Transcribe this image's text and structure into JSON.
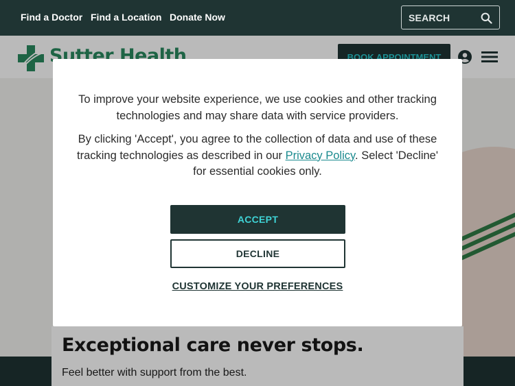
{
  "topbar": {
    "links": [
      "Find a Doctor",
      "Find a Location",
      "Donate Now"
    ],
    "search_placeholder": "SEARCH",
    "search_icon": "search-icon"
  },
  "header": {
    "logo_text": "Sutter Health",
    "book_label": "BOOK APPOINTMENT",
    "account_icon": "account-icon",
    "menu_icon": "hamburger-menu-icon"
  },
  "hero": {
    "title": "Exceptional care never stops.",
    "subtitle": "Feel better with support from the best."
  },
  "cookie_modal": {
    "paragraph1": "To improve your website experience, we use cookies and other tracking technologies and may share data with service providers.",
    "paragraph2_before": "By clicking 'Accept', you agree to the collection of data and use of these tracking technologies as described in our ",
    "privacy_link": "Privacy Policy",
    "paragraph2_after": ". Select 'Decline' for essential cookies only.",
    "accept_label": "ACCEPT",
    "decline_label": "DECLINE",
    "customize_label": "CUSTOMIZE YOUR PREFERENCES"
  },
  "colors": {
    "dark_teal": "#1f3433",
    "accent_cyan": "#3fd3d6",
    "brand_green": "#2a8a5f",
    "link_teal": "#1a8a8e"
  }
}
